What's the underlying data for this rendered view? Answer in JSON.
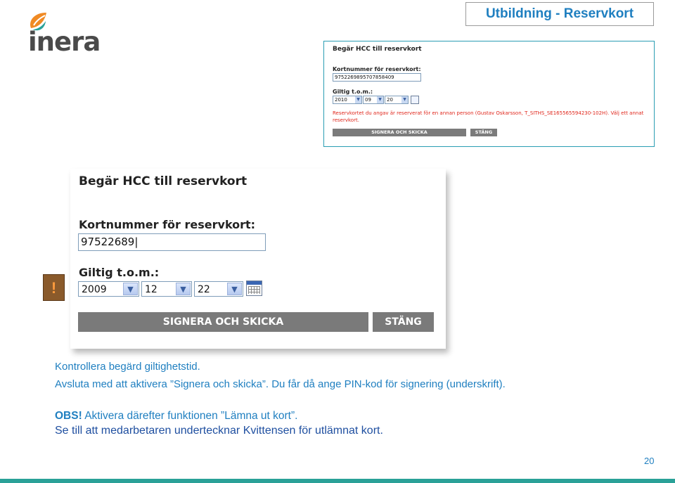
{
  "brand": {
    "logo_text": "inera"
  },
  "slide_title": "Utbildning - Reservkort",
  "small_screenshot": {
    "title": "Begär HCC till reservkort",
    "card_label": "Kortnummer för reservkort:",
    "card_value": "9752269895707858409",
    "valid_label": "Giltig t.o.m.:",
    "year": "2010",
    "month": "09",
    "day": "20",
    "error_text": "Reservkortet du angav är reserverat för en annan person (Gustav Oskarsson, T_SITHS_SE165565594230-102H). Välj ett annat reservkort.",
    "sign_button": "SIGNERA OCH SKICKA",
    "close_button": "STÄNG"
  },
  "large_screenshot": {
    "title": "Begär HCC till reservkort",
    "card_label": "Kortnummer för reservkort:",
    "card_value": "97522689",
    "valid_label": "Giltig t.o.m.:",
    "year": "2009",
    "month": "12",
    "day": "22",
    "sign_button": "SIGNERA OCH SKICKA",
    "close_button": "STÄNG"
  },
  "warning_glyph": "!",
  "captions": {
    "line1": "Kontrollera begärd giltighetstid.",
    "line2": "Avsluta med att aktivera ”Signera och skicka”. Du får då ange PIN-kod för signering (underskrift).",
    "obs_label": "OBS!",
    "obs_text": " Aktivera därefter funktionen ”Lämna ut kort”.",
    "line4": "Se till att medarbetaren undertecknar Kvittensen för utlämnat kort."
  },
  "page_number": "20",
  "colors": {
    "accent_blue": "#1f7fc0",
    "teal": "#2aa198",
    "error_red": "#e0261b"
  }
}
